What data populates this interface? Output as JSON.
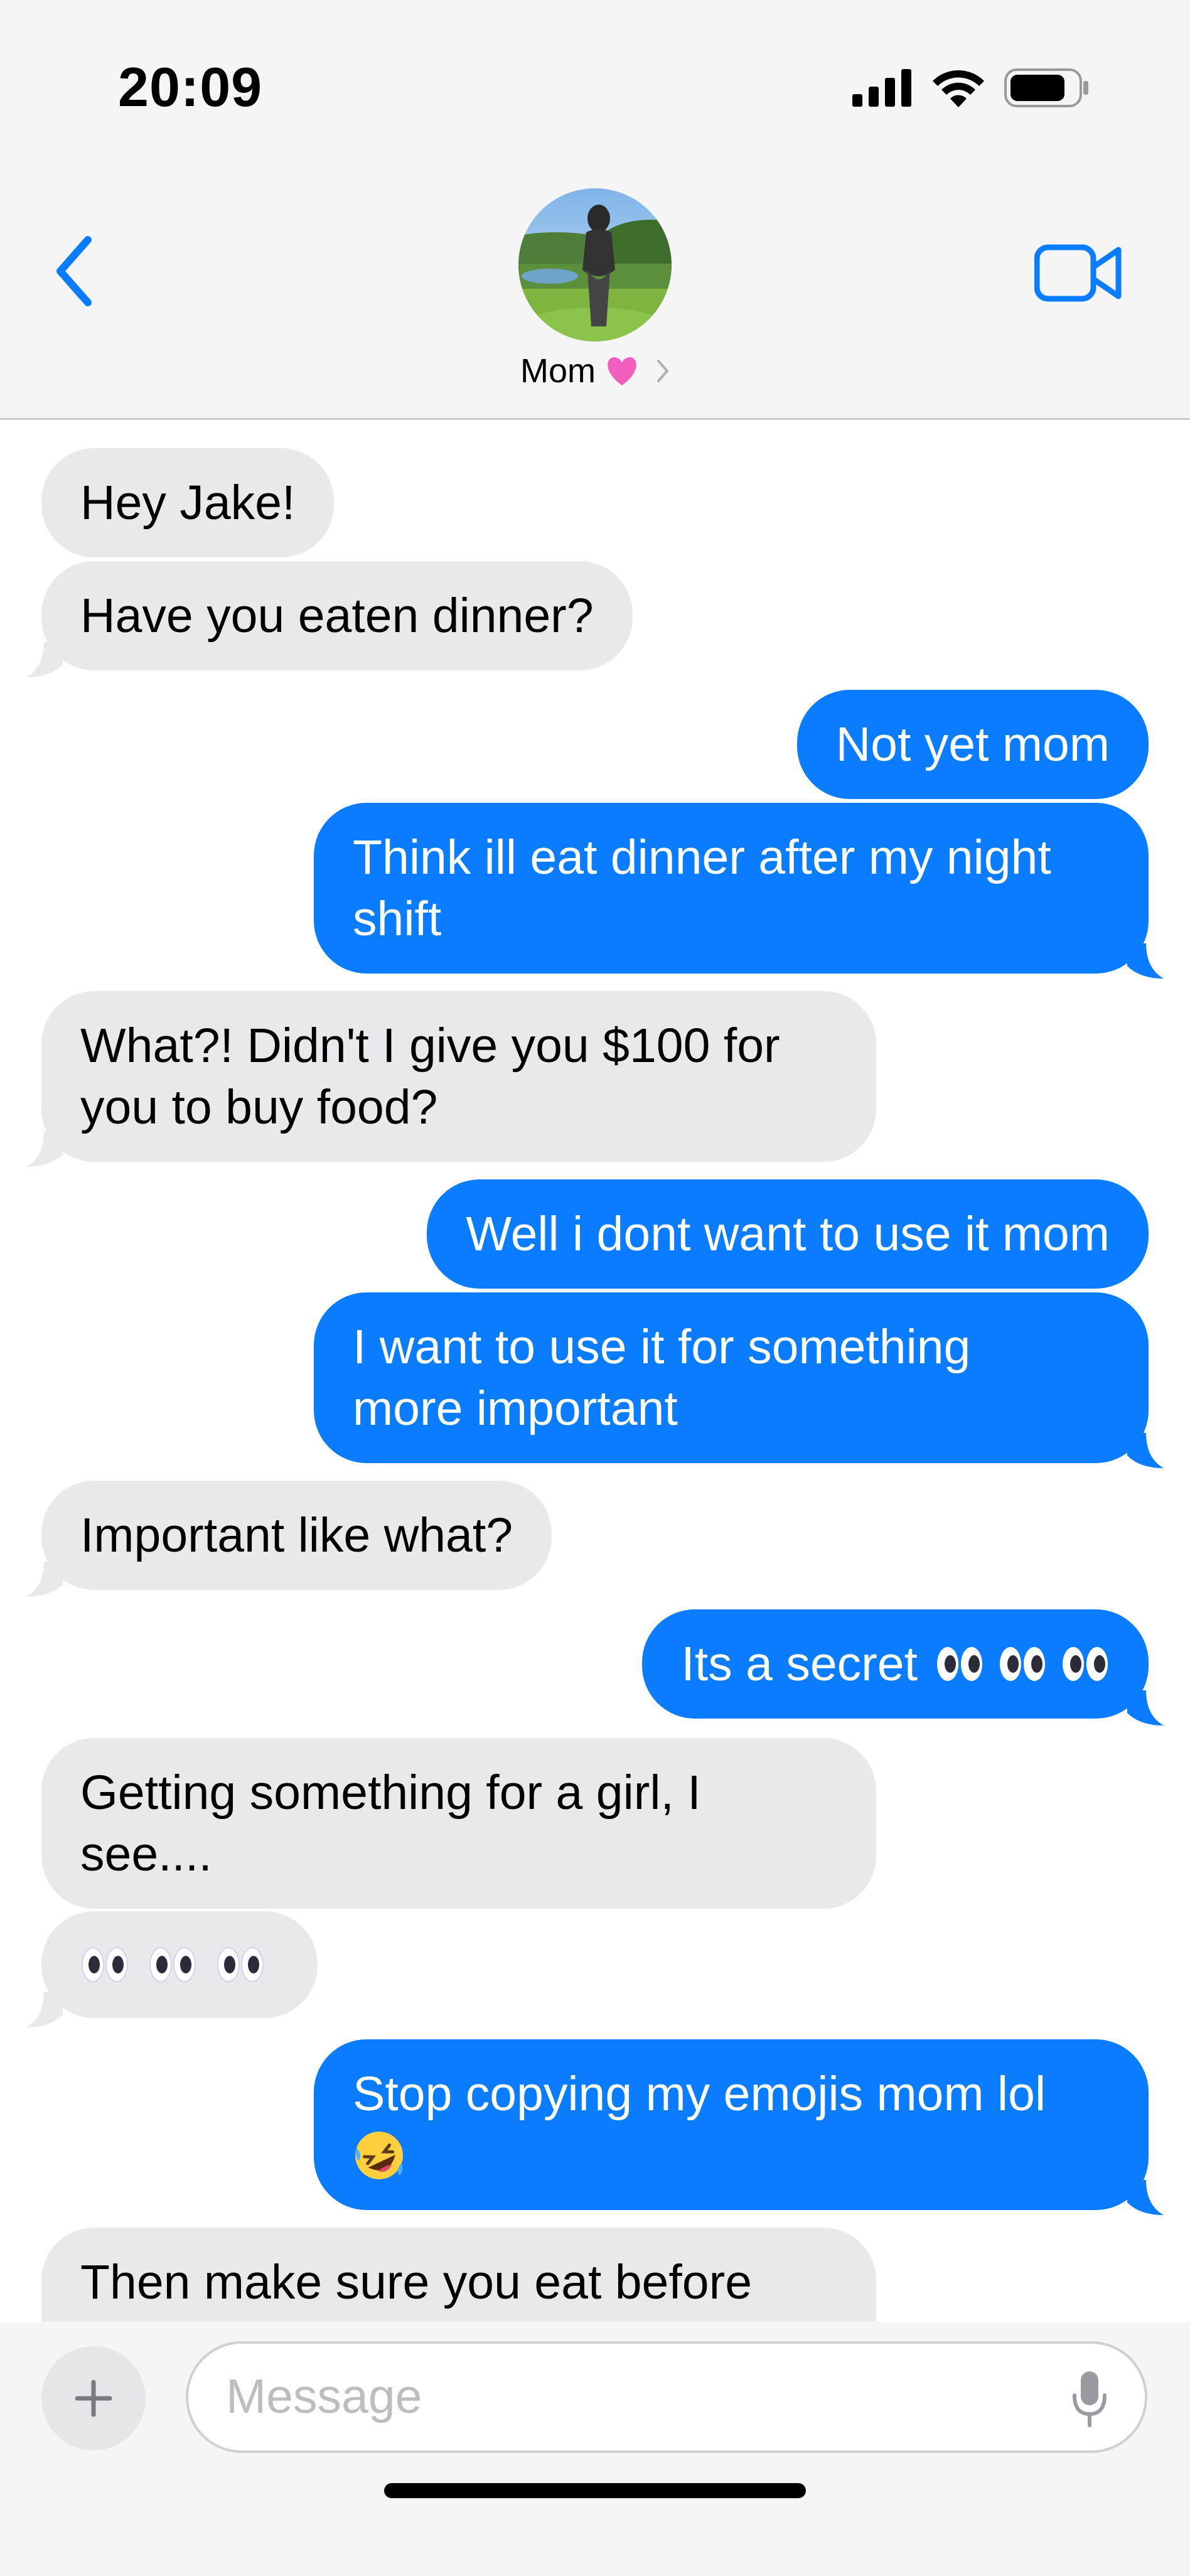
{
  "status_bar": {
    "time": "20:09"
  },
  "header": {
    "contact_name": "Mom"
  },
  "messages": [
    {
      "from": "them",
      "text": "Hey Jake!"
    },
    {
      "from": "them",
      "text": "Have you eaten dinner?"
    },
    {
      "from": "me",
      "text": "Not yet mom"
    },
    {
      "from": "me",
      "line1": "Think ill eat dinner after my night",
      "line2": "shift"
    },
    {
      "from": "them",
      "line1": "What?! Didn't I give you $100 for",
      "line2": "you to buy food?"
    },
    {
      "from": "me",
      "text": "Well i dont want to use it mom"
    },
    {
      "from": "me",
      "line1": "I want to use it for something",
      "line2": "more important"
    },
    {
      "from": "them",
      "text": "Important like what?"
    },
    {
      "from": "me",
      "text": "Its a secret"
    },
    {
      "from": "them",
      "line1": "Getting something for a girl, I",
      "line2": "see...."
    },
    {
      "from": "them",
      "text": ""
    },
    {
      "from": "me",
      "line1": "Stop copying my emojis mom lol"
    },
    {
      "from": "them",
      "line1": "Then make sure you eat before"
    }
  ],
  "composer": {
    "placeholder": "Message"
  },
  "colors": {
    "outgoing": "#0a7cff",
    "incoming": "#e9e9eb",
    "accent": "#0a7cff"
  }
}
